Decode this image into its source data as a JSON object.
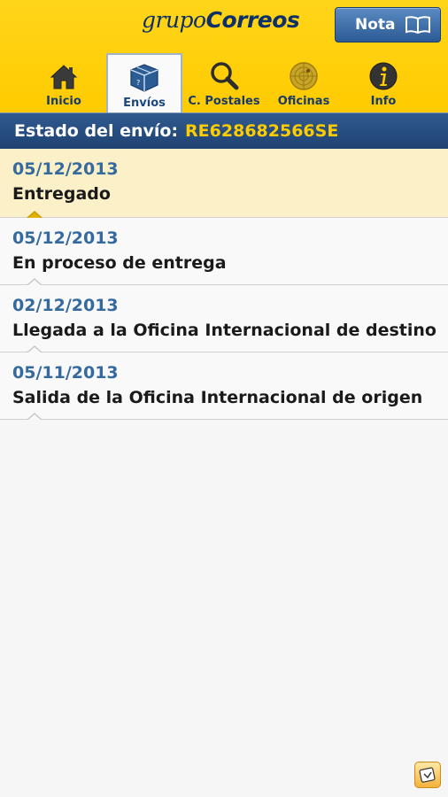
{
  "header": {
    "logo_part1": "grupo",
    "logo_part2": "Correos",
    "nota_label": "Nota"
  },
  "tabs": [
    {
      "label": "Inicio",
      "icon": "home-icon"
    },
    {
      "label": "Envíos",
      "icon": "package-icon",
      "active": true
    },
    {
      "label": "C. Postales",
      "icon": "search-icon"
    },
    {
      "label": "Oficinas",
      "icon": "radar-icon"
    },
    {
      "label": "Info",
      "icon": "info-icon"
    }
  ],
  "status": {
    "label": "Estado del envío:",
    "tracking": "RE628682566SE"
  },
  "events": [
    {
      "date": "05/12/2013",
      "description": "Entregado",
      "highlighted": true
    },
    {
      "date": "05/12/2013",
      "description": "En proceso de entrega"
    },
    {
      "date": "02/12/2013",
      "description": "Llegada a la Oficina Internacional de destino"
    },
    {
      "date": "05/11/2013",
      "description": "Salida de la Oficina Internacional de origen"
    }
  ],
  "colors": {
    "brand_yellow": "#ffcc00",
    "brand_blue": "#1f4273",
    "date_blue": "#356a9f"
  }
}
